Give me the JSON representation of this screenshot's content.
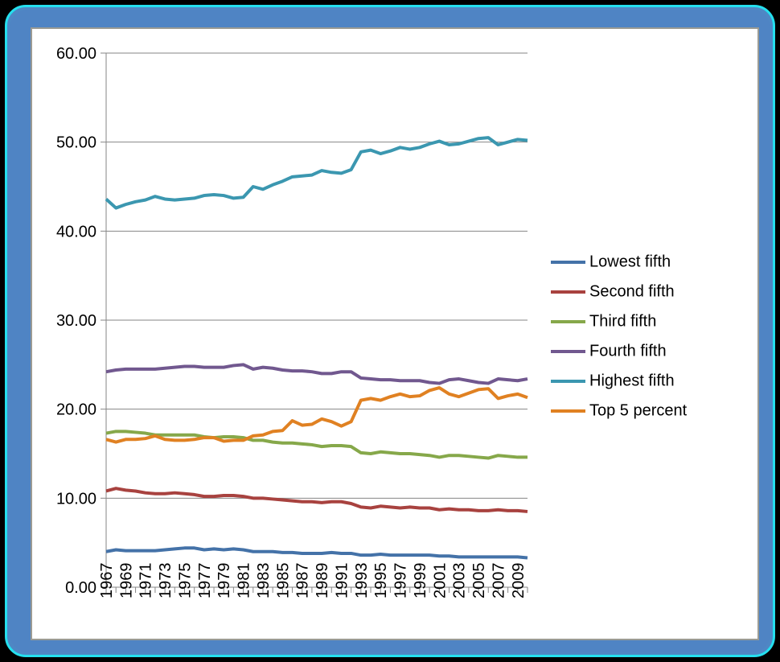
{
  "frame": {
    "border_color": "#4f84c4",
    "outer_glow_color": "#25e0ef",
    "background_color": "#000000",
    "card_background": "#ffffff",
    "card_border_color": "#9b9b94"
  },
  "chart_data": {
    "type": "line",
    "title": "",
    "subtitle": "",
    "xlabel": "",
    "ylabel": "",
    "ylim": [
      0,
      60
    ],
    "ytick_step": 10,
    "grid": true,
    "legend_position": "right",
    "ytick_labels": [
      "0.00",
      "10.00",
      "20.00",
      "30.00",
      "40.00",
      "50.00",
      "60.00"
    ],
    "ytick_values": [
      0,
      10,
      20,
      30,
      40,
      50,
      60
    ],
    "x": [
      1967,
      1968,
      1969,
      1970,
      1971,
      1972,
      1973,
      1974,
      1975,
      1976,
      1977,
      1978,
      1979,
      1980,
      1981,
      1982,
      1983,
      1984,
      1985,
      1986,
      1987,
      1988,
      1989,
      1990,
      1991,
      1992,
      1993,
      1994,
      1995,
      1996,
      1997,
      1998,
      1999,
      2000,
      2001,
      2002,
      2003,
      2004,
      2005,
      2006,
      2007,
      2008,
      2009,
      2010
    ],
    "xtick_labels": [
      "1967",
      "1969",
      "1971",
      "1973",
      "1975",
      "1977",
      "1979",
      "1981",
      "1983",
      "1985",
      "1987",
      "1989",
      "1991",
      "1993",
      "1995",
      "1997",
      "1999",
      "2001",
      "2003",
      "2005",
      "2007",
      "2009"
    ],
    "xtick_label_step": 2,
    "xtick_label_rotation": -90,
    "series": [
      {
        "name": "Lowest fifth",
        "color": "#4472a8",
        "values": [
          4.0,
          4.2,
          4.1,
          4.1,
          4.1,
          4.1,
          4.2,
          4.3,
          4.4,
          4.4,
          4.2,
          4.3,
          4.2,
          4.3,
          4.2,
          4.0,
          4.0,
          4.0,
          3.9,
          3.9,
          3.8,
          3.8,
          3.8,
          3.9,
          3.8,
          3.8,
          3.6,
          3.6,
          3.7,
          3.6,
          3.6,
          3.6,
          3.6,
          3.6,
          3.5,
          3.5,
          3.4,
          3.4,
          3.4,
          3.4,
          3.4,
          3.4,
          3.4,
          3.3
        ]
      },
      {
        "name": "Second fifth",
        "color": "#a8423f",
        "values": [
          10.8,
          11.1,
          10.9,
          10.8,
          10.6,
          10.5,
          10.5,
          10.6,
          10.5,
          10.4,
          10.2,
          10.2,
          10.3,
          10.3,
          10.2,
          10.0,
          10.0,
          9.9,
          9.8,
          9.7,
          9.6,
          9.6,
          9.5,
          9.6,
          9.6,
          9.4,
          9.0,
          8.9,
          9.1,
          9.0,
          8.9,
          9.0,
          8.9,
          8.9,
          8.7,
          8.8,
          8.7,
          8.7,
          8.6,
          8.6,
          8.7,
          8.6,
          8.6,
          8.5
        ]
      },
      {
        "name": "Third fifth",
        "color": "#86a84a",
        "values": [
          17.3,
          17.5,
          17.5,
          17.4,
          17.3,
          17.1,
          17.1,
          17.1,
          17.1,
          17.1,
          16.9,
          16.8,
          16.9,
          16.9,
          16.8,
          16.5,
          16.5,
          16.3,
          16.2,
          16.2,
          16.1,
          16.0,
          15.8,
          15.9,
          15.9,
          15.8,
          15.1,
          15.0,
          15.2,
          15.1,
          15.0,
          15.0,
          14.9,
          14.8,
          14.6,
          14.8,
          14.8,
          14.7,
          14.6,
          14.5,
          14.8,
          14.7,
          14.6,
          14.6
        ]
      },
      {
        "name": "Fourth fifth",
        "color": "#71588f",
        "values": [
          24.2,
          24.4,
          24.5,
          24.5,
          24.5,
          24.5,
          24.6,
          24.7,
          24.8,
          24.8,
          24.7,
          24.7,
          24.7,
          24.9,
          25.0,
          24.5,
          24.7,
          24.6,
          24.4,
          24.3,
          24.3,
          24.2,
          24.0,
          24.0,
          24.2,
          24.2,
          23.5,
          23.4,
          23.3,
          23.3,
          23.2,
          23.2,
          23.2,
          23.0,
          22.9,
          23.3,
          23.4,
          23.2,
          23.0,
          22.9,
          23.4,
          23.3,
          23.2,
          23.4
        ]
      },
      {
        "name": "Highest fifth",
        "color": "#3b97b0",
        "values": [
          43.6,
          42.6,
          43.0,
          43.3,
          43.5,
          43.9,
          43.6,
          43.5,
          43.6,
          43.7,
          44.0,
          44.1,
          44.0,
          43.7,
          43.8,
          45.0,
          44.7,
          45.2,
          45.6,
          46.1,
          46.2,
          46.3,
          46.8,
          46.6,
          46.5,
          46.9,
          48.9,
          49.1,
          48.7,
          49.0,
          49.4,
          49.2,
          49.4,
          49.8,
          50.1,
          49.7,
          49.8,
          50.1,
          50.4,
          50.5,
          49.7,
          50.0,
          50.3,
          50.2
        ]
      },
      {
        "name": "Top 5 percent",
        "color": "#e08122",
        "values": [
          16.6,
          16.3,
          16.6,
          16.6,
          16.7,
          17.0,
          16.6,
          16.5,
          16.5,
          16.6,
          16.8,
          16.8,
          16.4,
          16.5,
          16.5,
          17.0,
          17.1,
          17.5,
          17.6,
          18.7,
          18.2,
          18.3,
          18.9,
          18.6,
          18.1,
          18.6,
          21.0,
          21.2,
          21.0,
          21.4,
          21.7,
          21.4,
          21.5,
          22.1,
          22.4,
          21.7,
          21.4,
          21.8,
          22.2,
          22.3,
          21.2,
          21.5,
          21.7,
          21.3
        ]
      }
    ]
  },
  "legend": {
    "items": [
      {
        "label": "Lowest fifth",
        "color": "#4472a8"
      },
      {
        "label": "Second fifth",
        "color": "#a8423f"
      },
      {
        "label": "Third fifth",
        "color": "#86a84a"
      },
      {
        "label": "Fourth fifth",
        "color": "#71588f"
      },
      {
        "label": "Highest fifth",
        "color": "#3b97b0"
      },
      {
        "label": "Top 5 percent",
        "color": "#e08122"
      }
    ]
  }
}
